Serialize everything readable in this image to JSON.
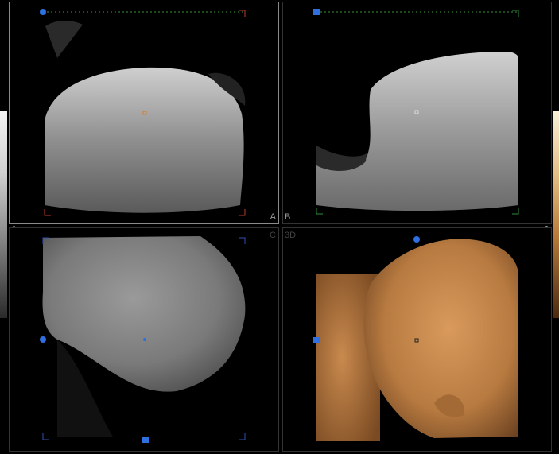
{
  "views": {
    "a": {
      "label": "A"
    },
    "b": {
      "label": "B"
    },
    "c": {
      "label": "C"
    },
    "d": {
      "label": "3D"
    }
  },
  "colors": {
    "pane_border_active": "#8a8a8a",
    "handle_blue": "#2f6fe0",
    "corner_red": "#c0392b",
    "corner_green": "#2e8b3a",
    "corner_blue": "#2f4fb0",
    "render_skin": "#c98a4e"
  },
  "icons": [
    "rotation-handle-icon",
    "center-crosshair-icon",
    "corner-bracket-icon"
  ]
}
